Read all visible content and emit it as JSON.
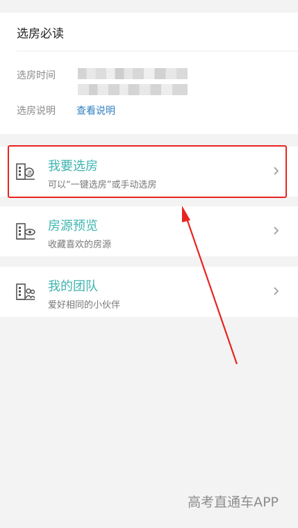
{
  "notice": {
    "title": "选房必读",
    "time_label": "选房时间",
    "desc_label": "选房说明",
    "desc_link": "查看说明"
  },
  "menu": [
    {
      "title": "我要选房",
      "subtitle": "可以“一键选房”或手动选房",
      "icon": "house-select-icon"
    },
    {
      "title": "房源预览",
      "subtitle": "收藏喜欢的房源",
      "icon": "house-preview-icon"
    },
    {
      "title": "我的团队",
      "subtitle": "爱好相同的小伙伴",
      "icon": "house-team-icon"
    }
  ],
  "watermark": "高考直通车APP",
  "colors": {
    "accent": "#3fb5b0",
    "link": "#2f7fc1",
    "highlight": "#e8231f",
    "background": "#f3f3f3"
  }
}
